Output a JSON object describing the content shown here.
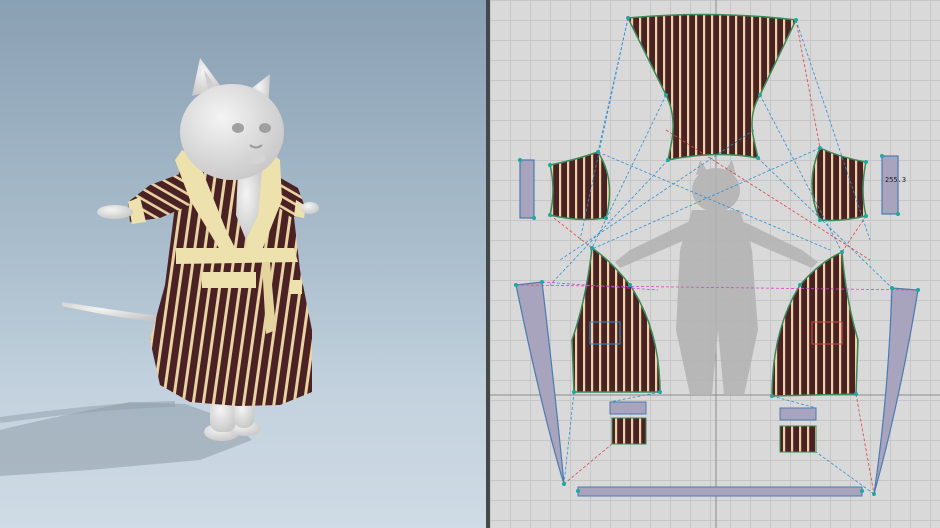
{
  "app": {
    "panels": [
      "3d-viewport",
      "2d-pattern-window"
    ]
  },
  "pattern": {
    "measurement_label": "255.3"
  },
  "colors": {
    "stripe_dark": "#4a2224",
    "stripe_light": "#e9d2a4",
    "robe_trim": "#ede1ad",
    "avatar": "#e6e6e6",
    "ribbon_fill": "#a9a4bd",
    "seam_blue": "#2f8fd6",
    "seam_red": "#d84848",
    "seam_magenta": "#d844c8",
    "point_teal": "#1ea8a0"
  }
}
